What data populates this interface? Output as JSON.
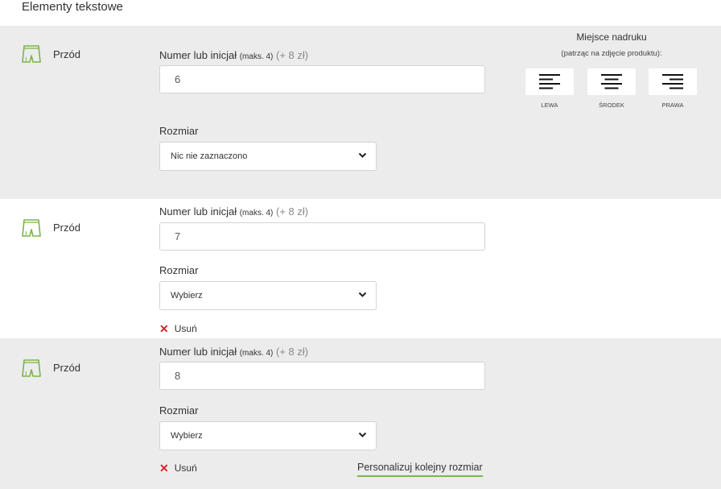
{
  "section_title": "Elementy tekstowe",
  "print_place": {
    "title": "Miejsce nadruku",
    "subtitle": "(patrząc na zdjęcie produktu):",
    "options": [
      {
        "label": "LEWA",
        "icon": "align-left-icon"
      },
      {
        "label": "ŚRODEK",
        "icon": "align-center-icon"
      },
      {
        "label": "PRAWA",
        "icon": "align-right-icon"
      }
    ]
  },
  "rows": [
    {
      "side_label": "Przód",
      "icon": "shorts-icon",
      "field_label_main": "Numer lub inicjał",
      "field_label_limit": "(maks. 4)",
      "field_label_price": "(+ 8 zł)",
      "value": "6",
      "size_label": "Rozmiar",
      "size_value": "Nic nie zaznaczono"
    },
    {
      "side_label": "Przód",
      "icon": "shorts-icon",
      "field_label_main": "Numer lub inicjał",
      "field_label_limit": "(maks. 4)",
      "field_label_price": "(+ 8 zł)",
      "value": "7",
      "size_label": "Rozmiar",
      "size_value": "Wybierz",
      "remove_label": "Usuń"
    },
    {
      "side_label": "Przód",
      "icon": "shorts-icon",
      "field_label_main": "Numer lub inicjał",
      "field_label_limit": "(maks. 4)",
      "field_label_price": "(+ 8 zł)",
      "value": "8",
      "size_label": "Rozmiar",
      "size_value": "Wybierz",
      "remove_label": "Usuń"
    }
  ],
  "more_link": "Personalizuj kolejny rozmiar",
  "colors": {
    "accent_green": "#7ab648",
    "remove_red": "#d9232d",
    "row_gray": "#ececec"
  }
}
